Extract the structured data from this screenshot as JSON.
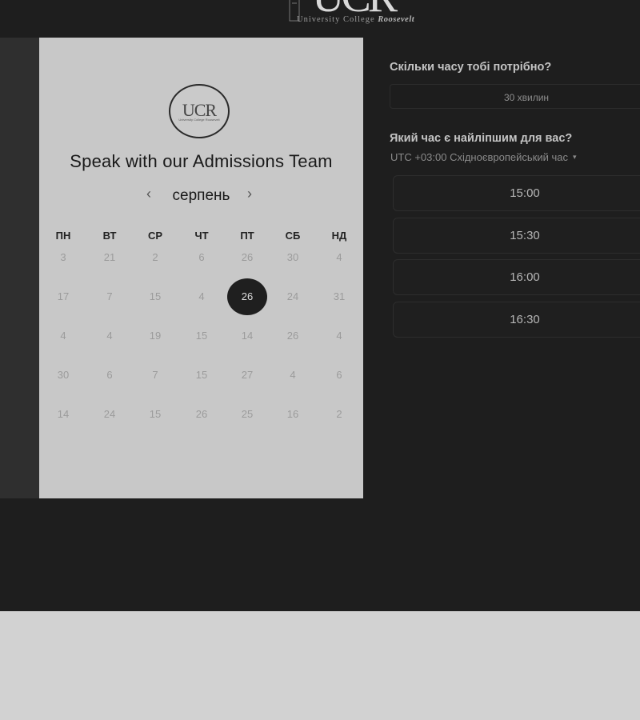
{
  "header": {
    "logo_text": "UCR",
    "subtitle_left": "University College",
    "subtitle_right": "Roosevelt"
  },
  "card": {
    "logo_text": "UCR",
    "logo_small_text": "University College Roosevelt",
    "title": "Speak with our Admissions Team",
    "month": "серпень",
    "prev_icon": "‹",
    "next_icon": "›",
    "weekdays": [
      "ПН",
      "ВТ",
      "СР",
      "ЧТ",
      "ПТ",
      "СБ",
      "НД"
    ],
    "weeks": [
      [
        "3",
        "21",
        "2",
        "6",
        "26",
        "30",
        "4"
      ],
      [
        "17",
        "7",
        "15",
        "4",
        "26",
        "24",
        "31"
      ],
      [
        "4",
        "4",
        "19",
        "15",
        "14",
        "26",
        "4"
      ],
      [
        "30",
        "6",
        "7",
        "15",
        "27",
        "4",
        "6"
      ],
      [
        "14",
        "24",
        "15",
        "26",
        "25",
        "16",
        "2"
      ]
    ],
    "selected": {
      "week": 1,
      "day": 4
    }
  },
  "scheduler": {
    "duration_question": "Скільки часу тобі потрібно?",
    "duration_value": "30 хвилин",
    "time_question": "Який час є найліпшим для вас?",
    "timezone": "UTC +03:00 Східноєвропейський час",
    "timezone_icon": "▾",
    "slots": [
      "15:00",
      "15:30",
      "16:00",
      "16:30"
    ]
  }
}
